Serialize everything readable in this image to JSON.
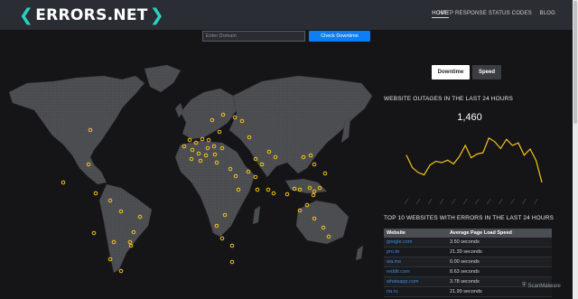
{
  "header": {
    "logo_text": "ERRORS.NET",
    "nav": [
      {
        "label": "HOME",
        "active": true
      },
      {
        "label": "HTTP RESPONSE STATUS CODES",
        "active": false
      },
      {
        "label": "BLOG",
        "active": false
      }
    ]
  },
  "search": {
    "placeholder": "Enter Domain",
    "button_label": "Check Downtime"
  },
  "tabs": [
    {
      "label": "Downtime",
      "active": true
    },
    {
      "label": "Speed",
      "active": false
    }
  ],
  "outages": {
    "title": "WEBSITE OUTAGES IN THE LAST 24 HOURS",
    "total": "1,460"
  },
  "chart_data": {
    "type": "line",
    "title": "",
    "xlabel": "",
    "ylabel": "",
    "series_color": "#f5c518",
    "x": [
      "",
      "",
      "",
      "",
      "",
      "",
      "",
      "",
      "",
      "",
      "",
      "",
      "",
      "",
      "",
      "",
      "",
      "",
      "",
      "",
      "",
      "",
      "",
      ""
    ],
    "values": [
      62,
      42,
      34,
      30,
      46,
      52,
      50,
      54,
      48,
      60,
      78,
      58,
      64,
      66,
      90,
      84,
      73,
      88,
      78,
      82,
      62,
      72,
      54,
      18
    ],
    "ylim": [
      0,
      100
    ]
  },
  "top10": {
    "title": "TOP 10 WEBSITES WITH ERRORS IN THE LAST 24 HOURS",
    "columns": [
      "Website",
      "Average Page Load Speed"
    ],
    "rows": [
      [
        "google.com",
        "3.50 seconds"
      ],
      [
        "pro.br",
        "21.39 seconds"
      ],
      [
        "wa.me",
        "0.00 seconds"
      ],
      [
        "reddit.com",
        "8.63 seconds"
      ],
      [
        "whatsapp.com",
        "3.78 seconds"
      ],
      [
        "ria.ru",
        "21.99 seconds"
      ]
    ]
  },
  "watermark": "ScanMalware",
  "colors": {
    "accent": "#2bd1c4",
    "button": "#0d7ef5",
    "marker": "#f5c518",
    "link": "#3d8ee0"
  }
}
